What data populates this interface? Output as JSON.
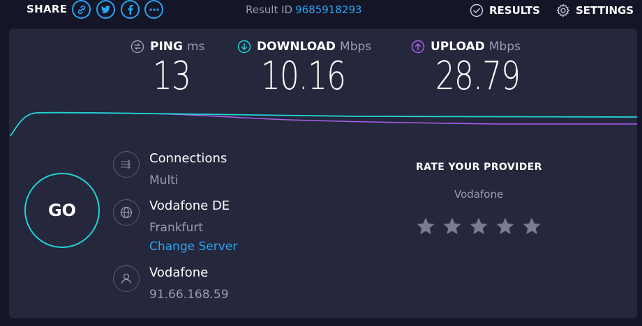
{
  "topbar": {
    "share_label": "SHARE",
    "share_icons": [
      "link-icon",
      "twitter-icon",
      "facebook-icon",
      "more-icon"
    ],
    "result_id_label": "Result ID",
    "result_id_value": "9685918293",
    "results_label": "RESULTS",
    "settings_label": "SETTINGS"
  },
  "metrics": {
    "ping": {
      "name": "PING",
      "unit": "ms",
      "value": "13"
    },
    "download": {
      "name": "DOWNLOAD",
      "unit": "Mbps",
      "value": "10.16"
    },
    "upload": {
      "name": "UPLOAD",
      "unit": "Mbps",
      "value": "28.79"
    }
  },
  "go_label": "GO",
  "connections": {
    "title": "Connections",
    "value": "Multi"
  },
  "server": {
    "title": "Vodafone DE",
    "location": "Frankfurt",
    "change_label": "Change Server"
  },
  "isp": {
    "title": "Vodafone",
    "ip": "91.66.168.59"
  },
  "rating": {
    "title": "RATE YOUR PROVIDER",
    "provider": "Vodafone",
    "stars": 5
  },
  "colors": {
    "accent": "#2aa5f5",
    "download": "#1fd5d4",
    "upload": "#a860ec",
    "panel": "#25273c",
    "background": "#141526"
  }
}
